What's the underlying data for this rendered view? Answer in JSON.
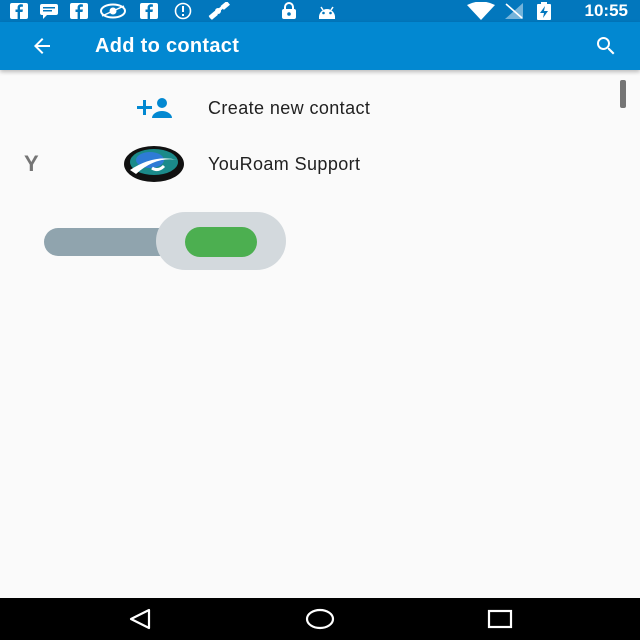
{
  "status_bar": {
    "time": "10:55",
    "notification_icons": [
      "facebook-icon",
      "message-icon",
      "facebook-icon",
      "eye-icon",
      "facebook-icon",
      "info-icon",
      "satellite-icon",
      "lock-icon",
      "android-icon"
    ],
    "system_icons": [
      "wifi-icon",
      "signal-off-icon",
      "battery-charging-icon"
    ]
  },
  "app_bar": {
    "title": "Add to contact",
    "back_icon": "arrow-back-icon",
    "search_icon": "search-icon"
  },
  "list": {
    "create_new": {
      "label": "Create new contact",
      "icon": "person-add-icon"
    },
    "section_letter": "Y",
    "contacts": [
      {
        "name": "YouRoam Support",
        "icon": "youroam-logo"
      }
    ]
  },
  "toggle": {
    "state": "on",
    "level": 1
  },
  "nav_bar": {
    "buttons": [
      "back-triangle-icon",
      "home-circle-icon",
      "recents-square-icon"
    ]
  },
  "colors": {
    "status_bar": "#0277bd",
    "app_bar": "#0288d1",
    "accent": "#0288d1",
    "toggle_thumb": "#4caf50",
    "toggle_track": "#90a4ae"
  }
}
